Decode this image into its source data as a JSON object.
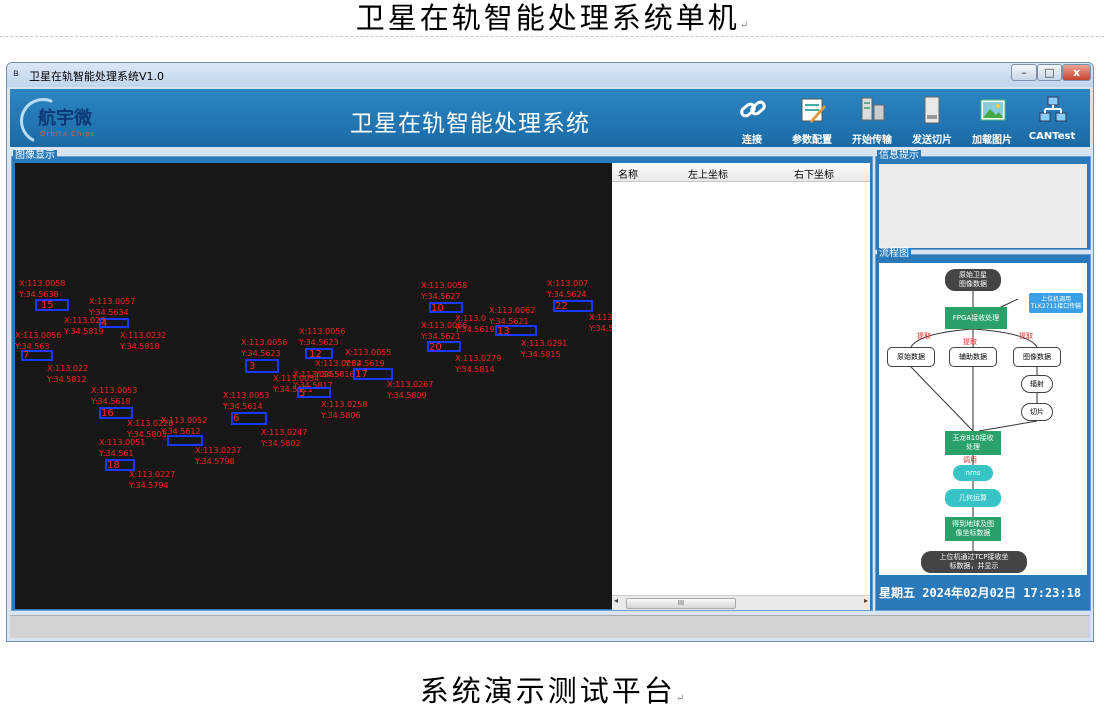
{
  "doc": {
    "title": "卫星在轨智能处理系统单机",
    "caption": "系统演示测试平台",
    "para_mark": "↵"
  },
  "window": {
    "title": "卫星在轨智能处理系统V1.0",
    "min": "–",
    "max": "□",
    "close": "x"
  },
  "header": {
    "logo_name": "航宇微",
    "logo_sub": "Orbita Chips",
    "app_title": "卫星在轨智能处理系统",
    "toolbar": [
      {
        "label": "连接",
        "icon": "link-icon"
      },
      {
        "label": "参数配置",
        "icon": "config-icon"
      },
      {
        "label": "开始传输",
        "icon": "server-icon"
      },
      {
        "label": "发送切片",
        "icon": "slice-icon"
      },
      {
        "label": "加载图片",
        "icon": "picture-icon"
      },
      {
        "label": "CANTest",
        "icon": "network-icon"
      }
    ]
  },
  "panels": {
    "image_group": "图像显示",
    "info_group": "信息提示",
    "flow_group": "流程图"
  },
  "table": {
    "columns": [
      "名称",
      "左上坐标",
      "右下坐标"
    ],
    "scroll_thumb": "III",
    "rows": []
  },
  "detections": [
    {
      "num": "15",
      "x": "113.0058",
      "y": "34.5638"
    },
    {
      "num": "4",
      "x": "113.0057",
      "y": "34.5634"
    },
    {
      "num": "",
      "x": "113.023",
      "y": "34.5819"
    },
    {
      "num": "",
      "x": "113.0232",
      "y": "34.5818"
    },
    {
      "num": "7",
      "x": "113.0056",
      "y": "34.563"
    },
    {
      "num": "",
      "x": "113.022",
      "y": "34.5812"
    },
    {
      "num": "3",
      "x": "113.0056",
      "y": "34.5623"
    },
    {
      "num": "12",
      "x": "113.0056",
      "y": "34.5623"
    },
    {
      "num": "",
      "x": "113.0055",
      "y": "34.5619"
    },
    {
      "num": "",
      "x": "113.0255",
      "y": "34.5817"
    },
    {
      "num": "",
      "x": "113.0054",
      "y": "34.5811"
    },
    {
      "num": "17",
      "x": "113.0262",
      "y": "34.5816"
    },
    {
      "num": "",
      "x": "113.0267",
      "y": "34.5809"
    },
    {
      "num": "5",
      "x": "113.0258",
      "y": "34.5806"
    },
    {
      "num": "10",
      "x": "113.0058",
      "y": "34.5627"
    },
    {
      "num": "22",
      "x": "113.007",
      "y": "34.5624"
    },
    {
      "num": "",
      "x": "113.0",
      "y": "34.5619"
    },
    {
      "num": "13",
      "x": "113.0062",
      "y": "34.5621"
    },
    {
      "num": "",
      "x": "113",
      "y": "34.5"
    },
    {
      "num": "20",
      "x": "113.0066",
      "y": "34.5621"
    },
    {
      "num": "",
      "x": "113.0291",
      "y": "34.5815"
    },
    {
      "num": "",
      "x": "113.0279",
      "y": "34.5814"
    },
    {
      "num": "16",
      "x": "113.0053",
      "y": "34.5618"
    },
    {
      "num": "",
      "x": "113.0228",
      "y": "34.5803"
    },
    {
      "num": "6",
      "x": "113.0053",
      "y": "34.5614"
    },
    {
      "num": "",
      "x": "113.0247",
      "y": "34.5802"
    },
    {
      "num": "",
      "x": "113.0052",
      "y": "34.5612"
    },
    {
      "num": "",
      "x": "113.0237",
      "y": "34.5798"
    },
    {
      "num": "18",
      "x": "113.0051",
      "y": "34.561"
    },
    {
      "num": "",
      "x": "113.0227",
      "y": "34.5794"
    }
  ],
  "flow": {
    "start": "原始卫星\n图像数据",
    "host": "上位机调用\nTLK2711接口传输",
    "fpga": "FPGA接收处理",
    "extract": "提取",
    "raw": "原始数据",
    "aux": "辅助数据",
    "img": "图像数据",
    "radiate": "辐射",
    "slice": "切片",
    "yulong": "玉龙810接收\n处理",
    "call": "调用",
    "nms": "nms",
    "geo": "几何运算",
    "coords": "得到地球及图\n像坐标数据",
    "end": "上位机通过TCP接收坐\n标数据，并显示"
  },
  "status": {
    "clock": "星期五 2024年02月02日 17:23:18"
  }
}
